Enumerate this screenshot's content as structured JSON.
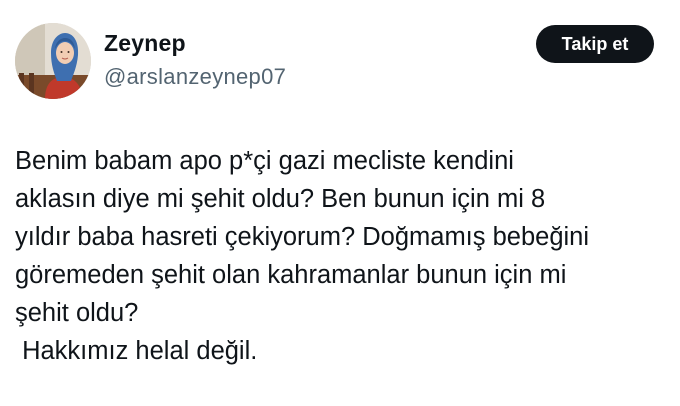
{
  "tweet": {
    "author": {
      "display_name": "Zeynep",
      "handle": "@arslanzeynep07",
      "avatar_icon": "profile-photo"
    },
    "follow_label": "Takip et",
    "body_lines": [
      "Benim babam apo p*çi gazi mecliste kendini",
      "aklasın diye mi şehit oldu? Ben bunun için mi 8",
      "yıldır baba hasreti çekiyorum? Doğmamış bebeğini",
      "göremeden şehit olan kahramanlar bunun için mi",
      "şehit oldu?",
      " Hakkımız helal değil."
    ]
  },
  "colors": {
    "text": "#0f1419",
    "secondary_text": "#536471",
    "button_bg": "#0f1419",
    "button_text": "#ffffff",
    "background": "#ffffff"
  }
}
